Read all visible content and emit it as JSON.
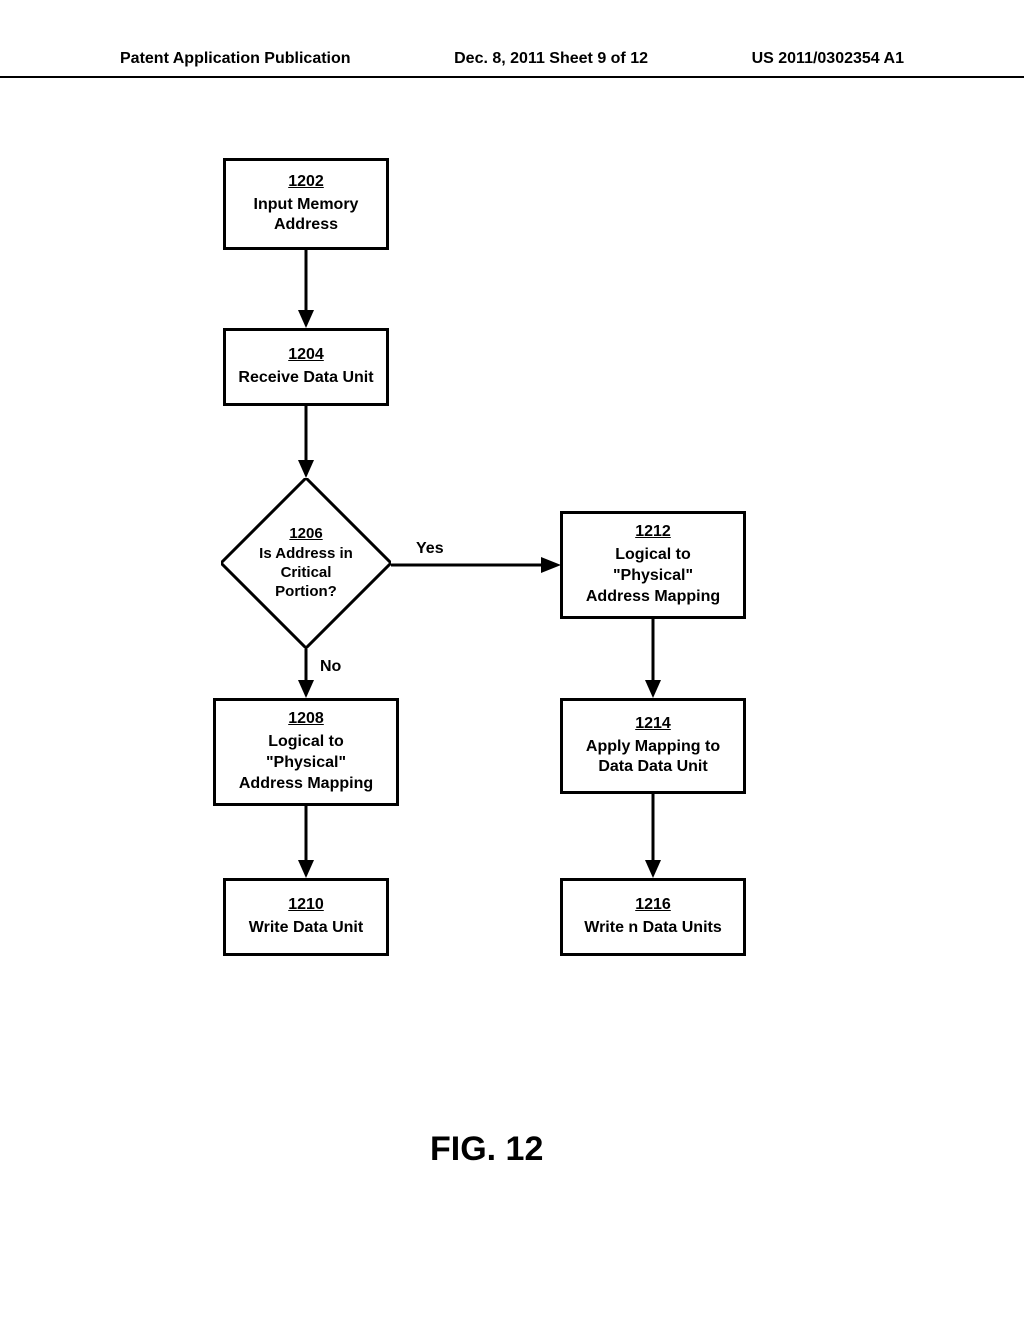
{
  "header": {
    "left": "Patent Application Publication",
    "center": "Dec. 8, 2011  Sheet 9 of 12",
    "right": "US 2011/0302354 A1"
  },
  "nodes": {
    "n1202": {
      "num": "1202",
      "text": "Input Memory\nAddress"
    },
    "n1204": {
      "num": "1204",
      "text": "Receive Data Unit"
    },
    "n1206": {
      "num": "1206",
      "text": "Is Address in\nCritical\nPortion?"
    },
    "n1208": {
      "num": "1208",
      "text": "Logical to\n\"Physical\"\nAddress Mapping"
    },
    "n1210": {
      "num": "1210",
      "text": "Write Data Unit"
    },
    "n1212": {
      "num": "1212",
      "text": "Logical to\n\"Physical\"\nAddress Mapping"
    },
    "n1214": {
      "num": "1214",
      "text": "Apply Mapping to\nData Data Unit"
    },
    "n1216": {
      "num": "1216",
      "text": "Write n Data Units"
    }
  },
  "edges": {
    "yes": "Yes",
    "no": "No"
  },
  "figure_caption": "FIG. 12",
  "chart_data": {
    "type": "flowchart",
    "title": "FIG. 12",
    "nodes": [
      {
        "id": "1202",
        "shape": "process",
        "label": "Input Memory Address"
      },
      {
        "id": "1204",
        "shape": "process",
        "label": "Receive Data Unit"
      },
      {
        "id": "1206",
        "shape": "decision",
        "label": "Is Address in Critical Portion?"
      },
      {
        "id": "1208",
        "shape": "process",
        "label": "Logical to \"Physical\" Address Mapping"
      },
      {
        "id": "1210",
        "shape": "process",
        "label": "Write Data Unit"
      },
      {
        "id": "1212",
        "shape": "process",
        "label": "Logical to \"Physical\" Address Mapping"
      },
      {
        "id": "1214",
        "shape": "process",
        "label": "Apply Mapping to Data Data Unit"
      },
      {
        "id": "1216",
        "shape": "process",
        "label": "Write n Data Units"
      }
    ],
    "edges": [
      {
        "from": "1202",
        "to": "1204",
        "label": ""
      },
      {
        "from": "1204",
        "to": "1206",
        "label": ""
      },
      {
        "from": "1206",
        "to": "1208",
        "label": "No"
      },
      {
        "from": "1206",
        "to": "1212",
        "label": "Yes"
      },
      {
        "from": "1208",
        "to": "1210",
        "label": ""
      },
      {
        "from": "1212",
        "to": "1214",
        "label": ""
      },
      {
        "from": "1214",
        "to": "1216",
        "label": ""
      }
    ]
  }
}
